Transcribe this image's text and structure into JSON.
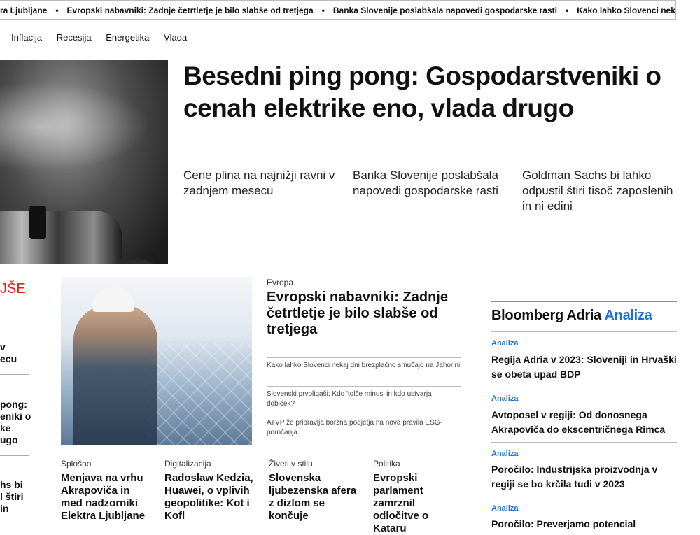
{
  "ticker": [
    "tra Ljubljane",
    "Evropski nabavniki: Zadnje četrtletje je bilo slabše od tretjega",
    "Banka Slovenije poslabšala napovedi gospodarske rasti",
    "Kako lahko Slovenci nekaj dni brezplačno smučajo"
  ],
  "nav": [
    "Inflacija",
    "Recesija",
    "Energetika",
    "Vlada"
  ],
  "hero": {
    "title": "Besedni ping pong: Gospodarstveniki o cenah elektrike eno, vlada drugo",
    "subs": [
      "Cene plina na najnižji ravni v zadnjem mesecu",
      "Banka Slovenije poslabšala napovedi gospodarske rasti",
      "Goldman Sachs bi lahko odpustil štiri tisoč zaposlenih in ni edini"
    ]
  },
  "left": {
    "heading": "JŠE",
    "fragments": [
      "v\necu",
      "pong:\neniki o\nke\nugo",
      "hs bi\nl štiri\nin"
    ]
  },
  "featured": {
    "category": "Evropa",
    "title": "Evropski nabavniki: Zadnje četrtletje je bilo slabše od tretjega",
    "related": [
      "Kako lahko Slovenci nekaj dni brezplačno smučajo na Jahorini",
      "Slovenski prvoligaši: Kdo 'tolče minus' in kdo ustvarja dobiček?",
      "ATVP že pripravlja borzna podjetja na nova pravila ESG-poročanja"
    ]
  },
  "cards": [
    {
      "category": "Splošno",
      "title": "Menjava na vrhu Akrapoviča in med nadzorniki Elektra Ljubljane"
    },
    {
      "category": "Digitalizacija",
      "title": "Radoslaw Kedzia, Huawei, o vplivih geopolitike: Kot i Kofl"
    },
    {
      "category": "Živeti v stilu",
      "title": "Slovenska ljubezenska afera z dizlom se končuje"
    },
    {
      "category": "Politika",
      "title": "Evropski parlament zamrznil odločitve o Kataru"
    }
  ],
  "bloomberg": {
    "brand": "Bloomberg Adria",
    "section": "Analiza",
    "items": [
      {
        "tag": "Analiza",
        "title": "Regija Adria v 2023: Sloveniji in Hrvaški se obeta upad BDP"
      },
      {
        "tag": "Analiza",
        "title": "Avtoposel v regiji: Od donosnega Akrapoviča do ekscentričnega Rimca"
      },
      {
        "tag": "Analiza",
        "title": "Poročilo: Industrijska proizvodnja v regiji se bo krčila tudi v 2023"
      },
      {
        "tag": "Analiza",
        "title": "Poročilo: Preverjamo potencial"
      }
    ]
  },
  "colors": {
    "accent": "#1f6fd1",
    "red": "#d7261e"
  }
}
